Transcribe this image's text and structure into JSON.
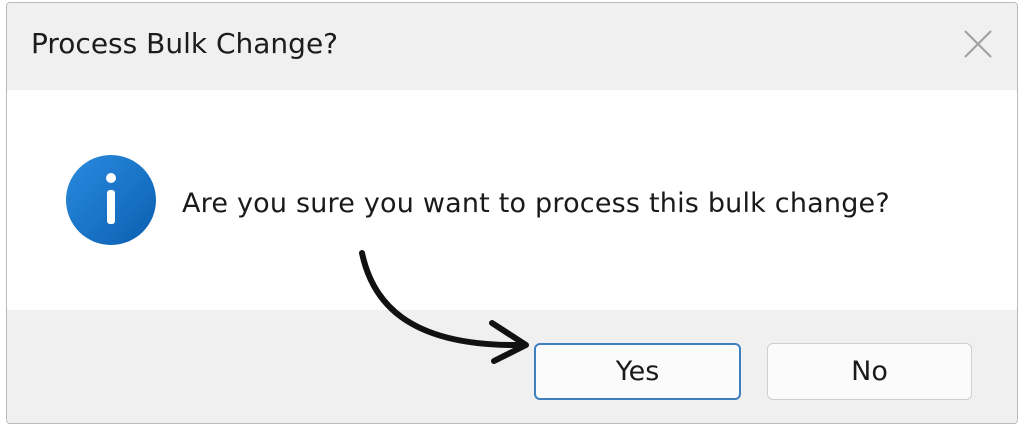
{
  "dialog": {
    "title": "Process Bulk Change?",
    "message": "Are you sure you want to process this bulk change?",
    "icon": "info-icon",
    "close_icon": "close-icon"
  },
  "buttons": {
    "yes_label": "Yes",
    "no_label": "No"
  },
  "annotation": {
    "arrow_icon": "curved-arrow-icon",
    "points_to": "Yes"
  },
  "colors": {
    "titlebar_bg": "#f0f0f0",
    "content_bg": "#ffffff",
    "info_icon_blue": "#0f6cbd",
    "default_button_border": "#3f7fbf",
    "arrow": "#111111"
  }
}
